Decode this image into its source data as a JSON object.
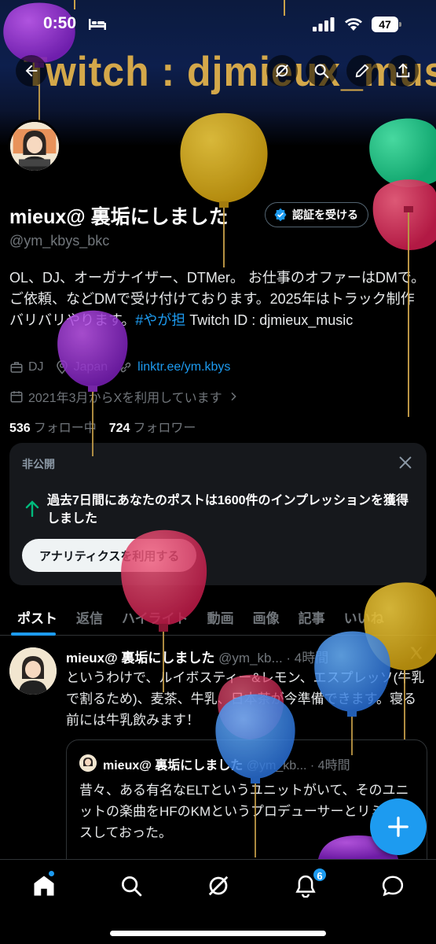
{
  "status_bar": {
    "time": "0:50",
    "battery": "47"
  },
  "banner": {
    "text": "Twitch : djmieux_music"
  },
  "profile": {
    "display_name": "mieux@ 裏垢にしました",
    "verify_button": "認証を受ける",
    "handle": "@ym_kbys_bkc",
    "bio_plain": "OL、DJ、オーガナイザー、DTMer。 お仕事のオファーはDMで。ご依頼、などDMで受け付けております。2025年はトラック制作バリバリやります。",
    "bio_hashtag": "#やが担",
    "bio_tail": " Twitch ID : djmieux_music",
    "category": "DJ",
    "location": "Japan",
    "link": "linktr.ee/ym.kbys",
    "joined": "2021年3月からXを利用しています",
    "following_count": "536",
    "following_label": "フォロー中",
    "followers_count": "724",
    "followers_label": "フォロワー"
  },
  "private_card": {
    "label": "非公開",
    "message": "過去7日間にあなたのポストは1600件のインプレッションを獲得しました",
    "button": "アナリティクスを利用する"
  },
  "tabs": [
    "ポスト",
    "返信",
    "ハイライト",
    "動画",
    "画像",
    "記事",
    "いいね"
  ],
  "tweet": {
    "name": "mieux@ 裏垢にしました",
    "meta": "@ym_kb... · 4時間",
    "body": "というわけで、ルイボスティー&レモン、エスプレッソ(牛乳で割るため)、麦茶、牛乳、日本茶が今準備できます。寝る前には牛乳飲みます！",
    "quote": {
      "name": "mieux@ 裏垢にしました",
      "meta": "@ym_kb... · 4時間",
      "body": "昔々、ある有名なELTというユニットがいて、そのユニットの楽曲をHFのKMというプロデューサーとリミックスしておった。"
    }
  },
  "bottom_nav": {
    "notifications_badge": "6"
  },
  "colors": {
    "accent": "#1d9bf0",
    "background": "#000000",
    "banner_text": "#d4a84a"
  }
}
